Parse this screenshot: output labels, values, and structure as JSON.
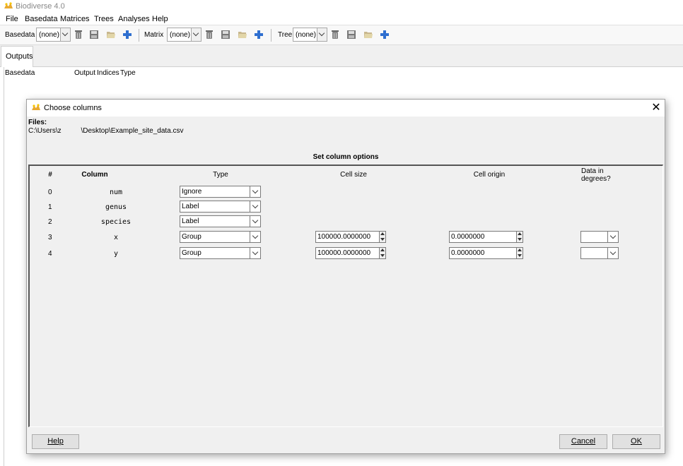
{
  "window": {
    "title": "Biodiverse 4.0"
  },
  "menu": [
    "File",
    "Basedata",
    "Matrices",
    "Trees",
    "Analyses",
    "Help"
  ],
  "toolbar": {
    "basedata_label": "Basedata",
    "basedata_value": "(none)",
    "matrix_label": "Matrix",
    "matrix_value": "(none)",
    "tree_label": "Tree",
    "tree_value": "(none)"
  },
  "tabs": {
    "outputs": "Outputs"
  },
  "outputs_table": {
    "col_basedata": "Basedata",
    "col_output": "Output",
    "col_indices": "Indices",
    "col_type": "Type"
  },
  "dialog": {
    "title": "Choose columns",
    "files_label": "Files:",
    "files_path": "C:\\Users\\z          \\Desktop\\Example_site_data.csv",
    "section_title": "Set column options",
    "headers": {
      "num": "#",
      "column": "Column",
      "type": "Type",
      "cell_size": "Cell size",
      "cell_origin": "Cell origin",
      "degrees_line1": "Data in",
      "degrees_line2": "degrees?"
    },
    "rows": [
      {
        "num": "0",
        "column": "num",
        "type": "Ignore"
      },
      {
        "num": "1",
        "column": "genus",
        "type": "Label"
      },
      {
        "num": "2",
        "column": "species",
        "type": "Label"
      },
      {
        "num": "3",
        "column": "x",
        "type": "Group",
        "cell_size": "100000.0000000",
        "cell_origin": "0.0000000",
        "degrees": ""
      },
      {
        "num": "4",
        "column": "y",
        "type": "Group",
        "cell_size": "100000.0000000",
        "cell_origin": "0.0000000",
        "degrees": ""
      }
    ],
    "buttons": {
      "help": "Help",
      "cancel": "Cancel",
      "ok": "OK"
    }
  },
  "colors": {
    "accent_folder": "#d9c67a",
    "plus_blue": "#2f6fd0"
  }
}
